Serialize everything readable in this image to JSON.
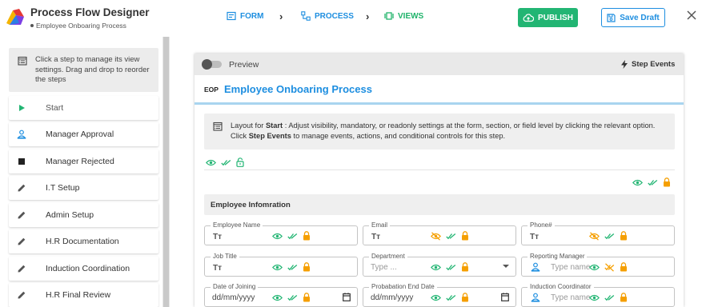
{
  "header": {
    "title": "Process Flow Designer",
    "subtitle": "Employee Onboaring Process",
    "steps": [
      {
        "label": "FORM",
        "icon": "form-icon"
      },
      {
        "label": "PROCESS",
        "icon": "process-icon"
      },
      {
        "label": "VIEWS",
        "icon": "views-icon"
      }
    ],
    "publish_label": "PUBLISH",
    "save_label": "Save Draft",
    "colors": {
      "accent": "#1d8ee0",
      "publish": "#22b573",
      "views": "#1fb36a"
    }
  },
  "sidebar": {
    "info": "Click a step to manage its view settings. Drag and drop to reorder the steps",
    "items": [
      {
        "label": "Start",
        "icon": "play-icon",
        "active": true
      },
      {
        "label": "Manager Approval",
        "icon": "person-icon"
      },
      {
        "label": "Manager Rejected",
        "icon": "stop-icon"
      },
      {
        "label": "I.T Setup",
        "icon": "pencil-icon"
      },
      {
        "label": "Admin Setup",
        "icon": "pencil-icon"
      },
      {
        "label": "H.R Documentation",
        "icon": "pencil-icon"
      },
      {
        "label": "Induction Coordination",
        "icon": "pencil-icon"
      },
      {
        "label": "H.R Final Review",
        "icon": "pencil-icon"
      }
    ]
  },
  "main": {
    "preview_label": "Preview",
    "step_events_label": "Step Events",
    "form_code": "EOP",
    "form_title": "Employee Onboaring Process",
    "note": {
      "p1": "Layout for ",
      "step": "Start",
      "p2": " : Adjust visibility, mandatory, or readonly settings at the form, section, or field level by clicking the relevant option.",
      "p3": "Click ",
      "events": "Step Events",
      "p4": " to manage events, actions, and conditional controls for this step."
    },
    "section_title": "Employee Infomration",
    "fields": [
      {
        "label": "Employee Name",
        "type_icon": "Tт"
      },
      {
        "label": "Email",
        "type_icon": "Tт"
      },
      {
        "label": "Phone#",
        "type_icon": "Tт"
      },
      {
        "label": "Job Title",
        "type_icon": "Tт"
      },
      {
        "label": "Department",
        "placeholder": "Type ..."
      },
      {
        "label": "Reporting Manager",
        "placeholder": "Type name"
      },
      {
        "label": "Date of Joining",
        "value": "dd/mm/yyyy"
      },
      {
        "label": "Probabation End Date",
        "value": "dd/mm/yyyy"
      },
      {
        "label": "Induction Coordinator",
        "placeholder": "Type name"
      }
    ]
  }
}
